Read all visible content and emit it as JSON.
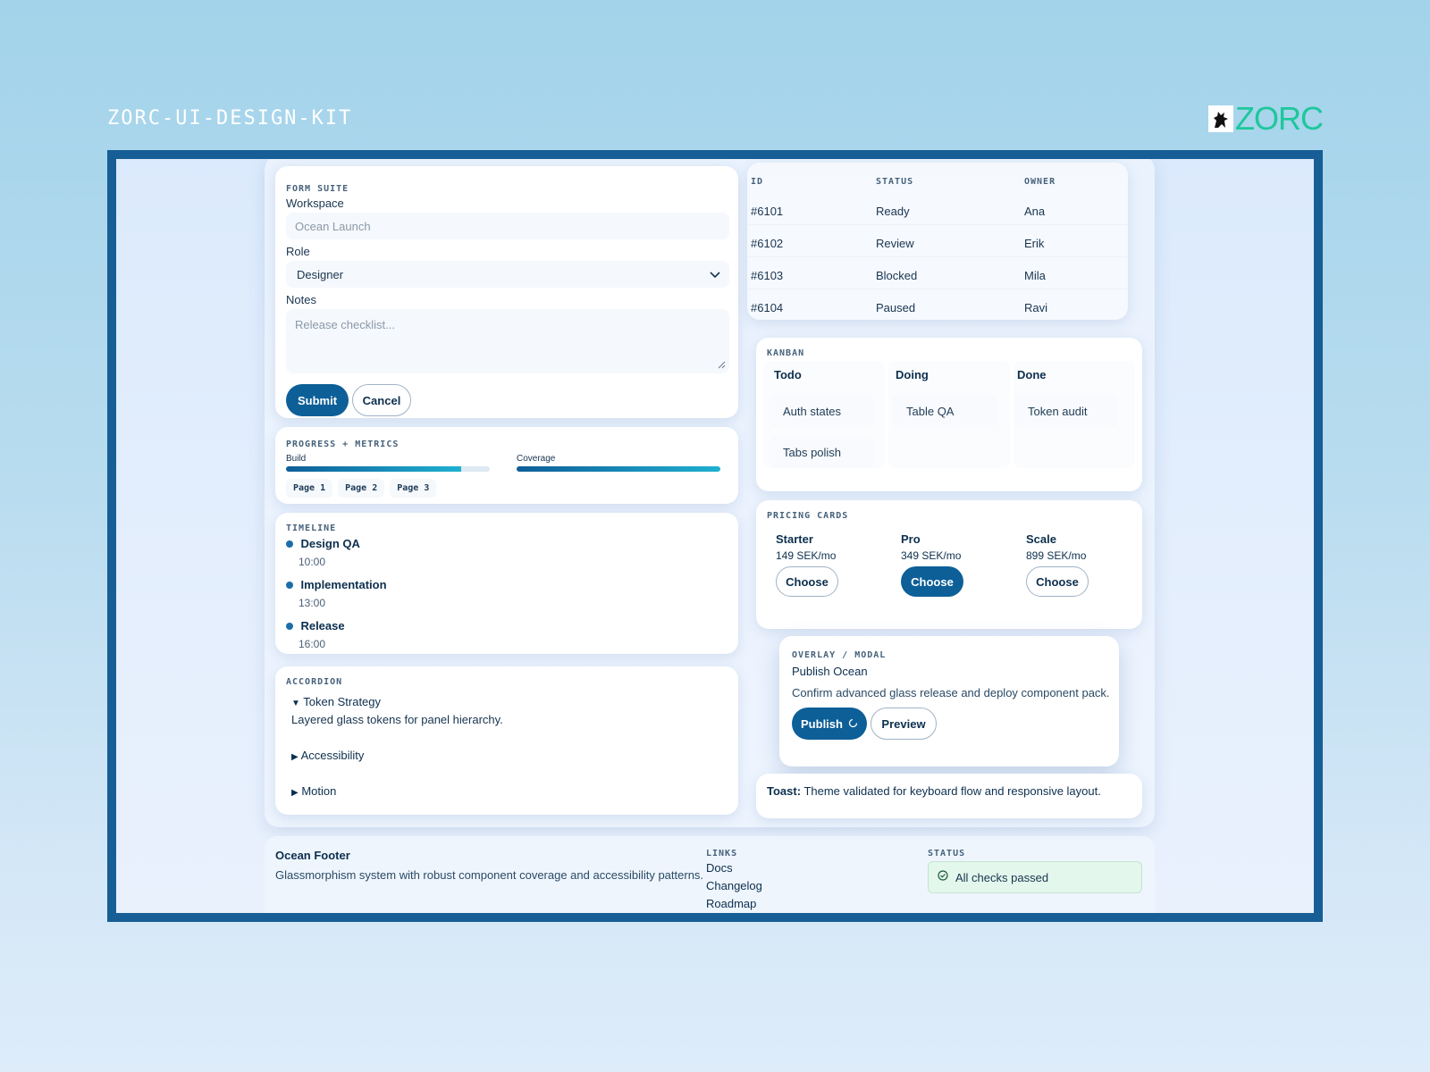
{
  "header": {
    "kit_title": "ZORC-UI-DESIGN-KIT",
    "logo_text": "ZORC",
    "logo_icon": "wolf-icon",
    "accent_color": "#1ec79c"
  },
  "form": {
    "section_label": "FORM SUITE",
    "workspace_label": "Workspace",
    "workspace_placeholder": "Ocean Launch",
    "role_label": "Role",
    "role_value": "Designer",
    "notes_label": "Notes",
    "notes_placeholder": "Release checklist...",
    "submit_label": "Submit",
    "cancel_label": "Cancel"
  },
  "table": {
    "headers": [
      "ID",
      "STATUS",
      "OWNER"
    ],
    "rows": [
      [
        "#6101",
        "Ready",
        "Ana"
      ],
      [
        "#6102",
        "Review",
        "Erik"
      ],
      [
        "#6103",
        "Blocked",
        "Mila"
      ],
      [
        "#6104",
        "Paused",
        "Ravi"
      ]
    ]
  },
  "progress": {
    "section_label": "PROGRESS + METRICS",
    "build_label": "Build",
    "build_value": 0.86,
    "coverage_label": "Coverage",
    "coverage_value": 1.0,
    "pages": [
      "Page 1",
      "Page 2",
      "Page 3"
    ]
  },
  "kanban": {
    "section_label": "KANBAN",
    "columns": [
      {
        "title": "Todo",
        "cards": [
          "Auth states",
          "Tabs polish"
        ]
      },
      {
        "title": "Doing",
        "cards": [
          "Table QA"
        ]
      },
      {
        "title": "Done",
        "cards": [
          "Token audit"
        ]
      }
    ]
  },
  "timeline": {
    "section_label": "TIMELINE",
    "events": [
      {
        "title": "Design QA",
        "time": "10:00"
      },
      {
        "title": "Implementation",
        "time": "13:00"
      },
      {
        "title": "Release",
        "time": "16:00"
      }
    ]
  },
  "pricing": {
    "section_label": "PRICING CARDS",
    "plans": [
      {
        "name": "Starter",
        "price": "149 SEK/mo",
        "cta": "Choose",
        "highlighted": false
      },
      {
        "name": "Pro",
        "price": "349 SEK/mo",
        "cta": "Choose",
        "highlighted": true
      },
      {
        "name": "Scale",
        "price": "899 SEK/mo",
        "cta": "Choose",
        "highlighted": false
      }
    ]
  },
  "modal": {
    "section_label": "OVERLAY / MODAL",
    "title": "Publish Ocean",
    "body": "Confirm advanced glass release and deploy component pack.",
    "publish_label": "Publish",
    "preview_label": "Preview"
  },
  "accordion": {
    "section_label": "ACCORDION",
    "items": [
      {
        "title": "Token Strategy",
        "body": "Layered glass tokens for panel hierarchy.",
        "expanded": true
      },
      {
        "title": "Accessibility",
        "expanded": false
      },
      {
        "title": "Motion",
        "expanded": false
      }
    ],
    "expanded_marker": "▼",
    "collapsed_marker": "▶"
  },
  "toast": {
    "label": "Toast:",
    "message": "Theme validated for keyboard flow and responsive layout."
  },
  "footer": {
    "title": "Ocean Footer",
    "description": "Glassmorphism system with robust component coverage and accessibility patterns.",
    "links_label": "LINKS",
    "links": [
      "Docs",
      "Changelog",
      "Roadmap"
    ],
    "status_label": "STATUS",
    "status_text": "All checks passed",
    "status_color": "#e4f7ec"
  }
}
